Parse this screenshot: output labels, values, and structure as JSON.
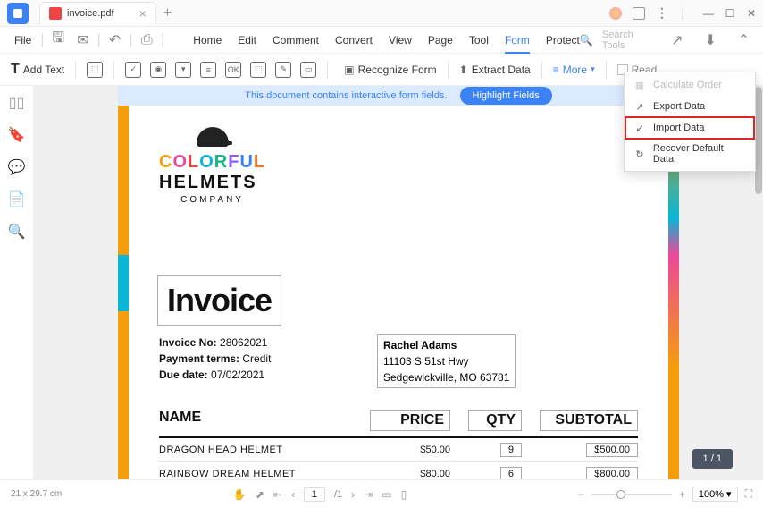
{
  "tab": {
    "name": "invoice.pdf"
  },
  "menubar": {
    "file": "File",
    "items": [
      "Home",
      "Edit",
      "Comment",
      "Convert",
      "View",
      "Page",
      "Tool",
      "Form",
      "Protect"
    ],
    "active": "Form",
    "search_placeholder": "Search Tools"
  },
  "toolbar": {
    "add_text": "Add Text",
    "recognize": "Recognize Form",
    "extract": "Extract Data",
    "more": "More",
    "read": "Read"
  },
  "banner": {
    "text": "This document contains interactive form fields.",
    "button": "Highlight Fields"
  },
  "dropdown": {
    "items": [
      {
        "label": "Calculate Order",
        "icon": "calc",
        "disabled": true
      },
      {
        "label": "Export Data",
        "icon": "export",
        "disabled": false
      },
      {
        "label": "Import Data",
        "icon": "import",
        "disabled": false,
        "highlighted": true
      },
      {
        "label": "Recover Default Data",
        "icon": "recover",
        "disabled": false
      }
    ]
  },
  "document": {
    "logo": {
      "word1": "COLORFUL",
      "word2": "HELMETS",
      "word3": "COMPANY"
    },
    "invoice_title": "Invoice",
    "details": {
      "no_label": "Invoice No:",
      "no_value": "28062021",
      "terms_label": "Payment terms:",
      "terms_value": "Credit",
      "due_label": "Due date:",
      "due_value": "07/02/2021"
    },
    "customer": {
      "name": "Rachel Adams",
      "addr1": "11103 S 51st Hwy",
      "addr2": "Sedgewickville, MO 63781"
    },
    "table": {
      "headers": {
        "name": "NAME",
        "price": "PRICE",
        "qty": "QTY",
        "subtotal": "SUBTOTAL"
      },
      "rows": [
        {
          "name": "DRAGON HEAD HELMET",
          "price": "$50.00",
          "qty": "9",
          "subtotal": "$500.00"
        },
        {
          "name": "RAINBOW DREAM HELMET",
          "price": "$80.00",
          "qty": "6",
          "subtotal": "$800.00"
        }
      ]
    }
  },
  "page_indicator": "1 / 1",
  "statusbar": {
    "dimensions": "21 x 29.7 cm",
    "page_current": "1",
    "page_total": "/1",
    "zoom": "100%"
  }
}
